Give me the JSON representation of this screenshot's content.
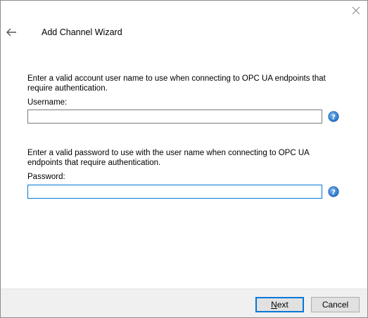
{
  "window": {
    "title": "Add Channel Wizard"
  },
  "username_section": {
    "description": "Enter a valid account user name to use when connecting to OPC UA endpoints that require authentication.",
    "label": "Username:",
    "value": ""
  },
  "password_section": {
    "description": "Enter a valid password to use with the user name when connecting to OPC UA endpoints that require authentication.",
    "label": "Password:",
    "value": ""
  },
  "footer": {
    "next_mnemonic": "N",
    "next_rest": "ext",
    "cancel_label": "Cancel"
  },
  "icons": {
    "back": "back-arrow-icon",
    "close": "close-icon",
    "help": "help-icon"
  },
  "colors": {
    "focus_border": "#0078d7",
    "help_blue": "#1e6fc6",
    "footer_bg": "#f0f0f0"
  }
}
